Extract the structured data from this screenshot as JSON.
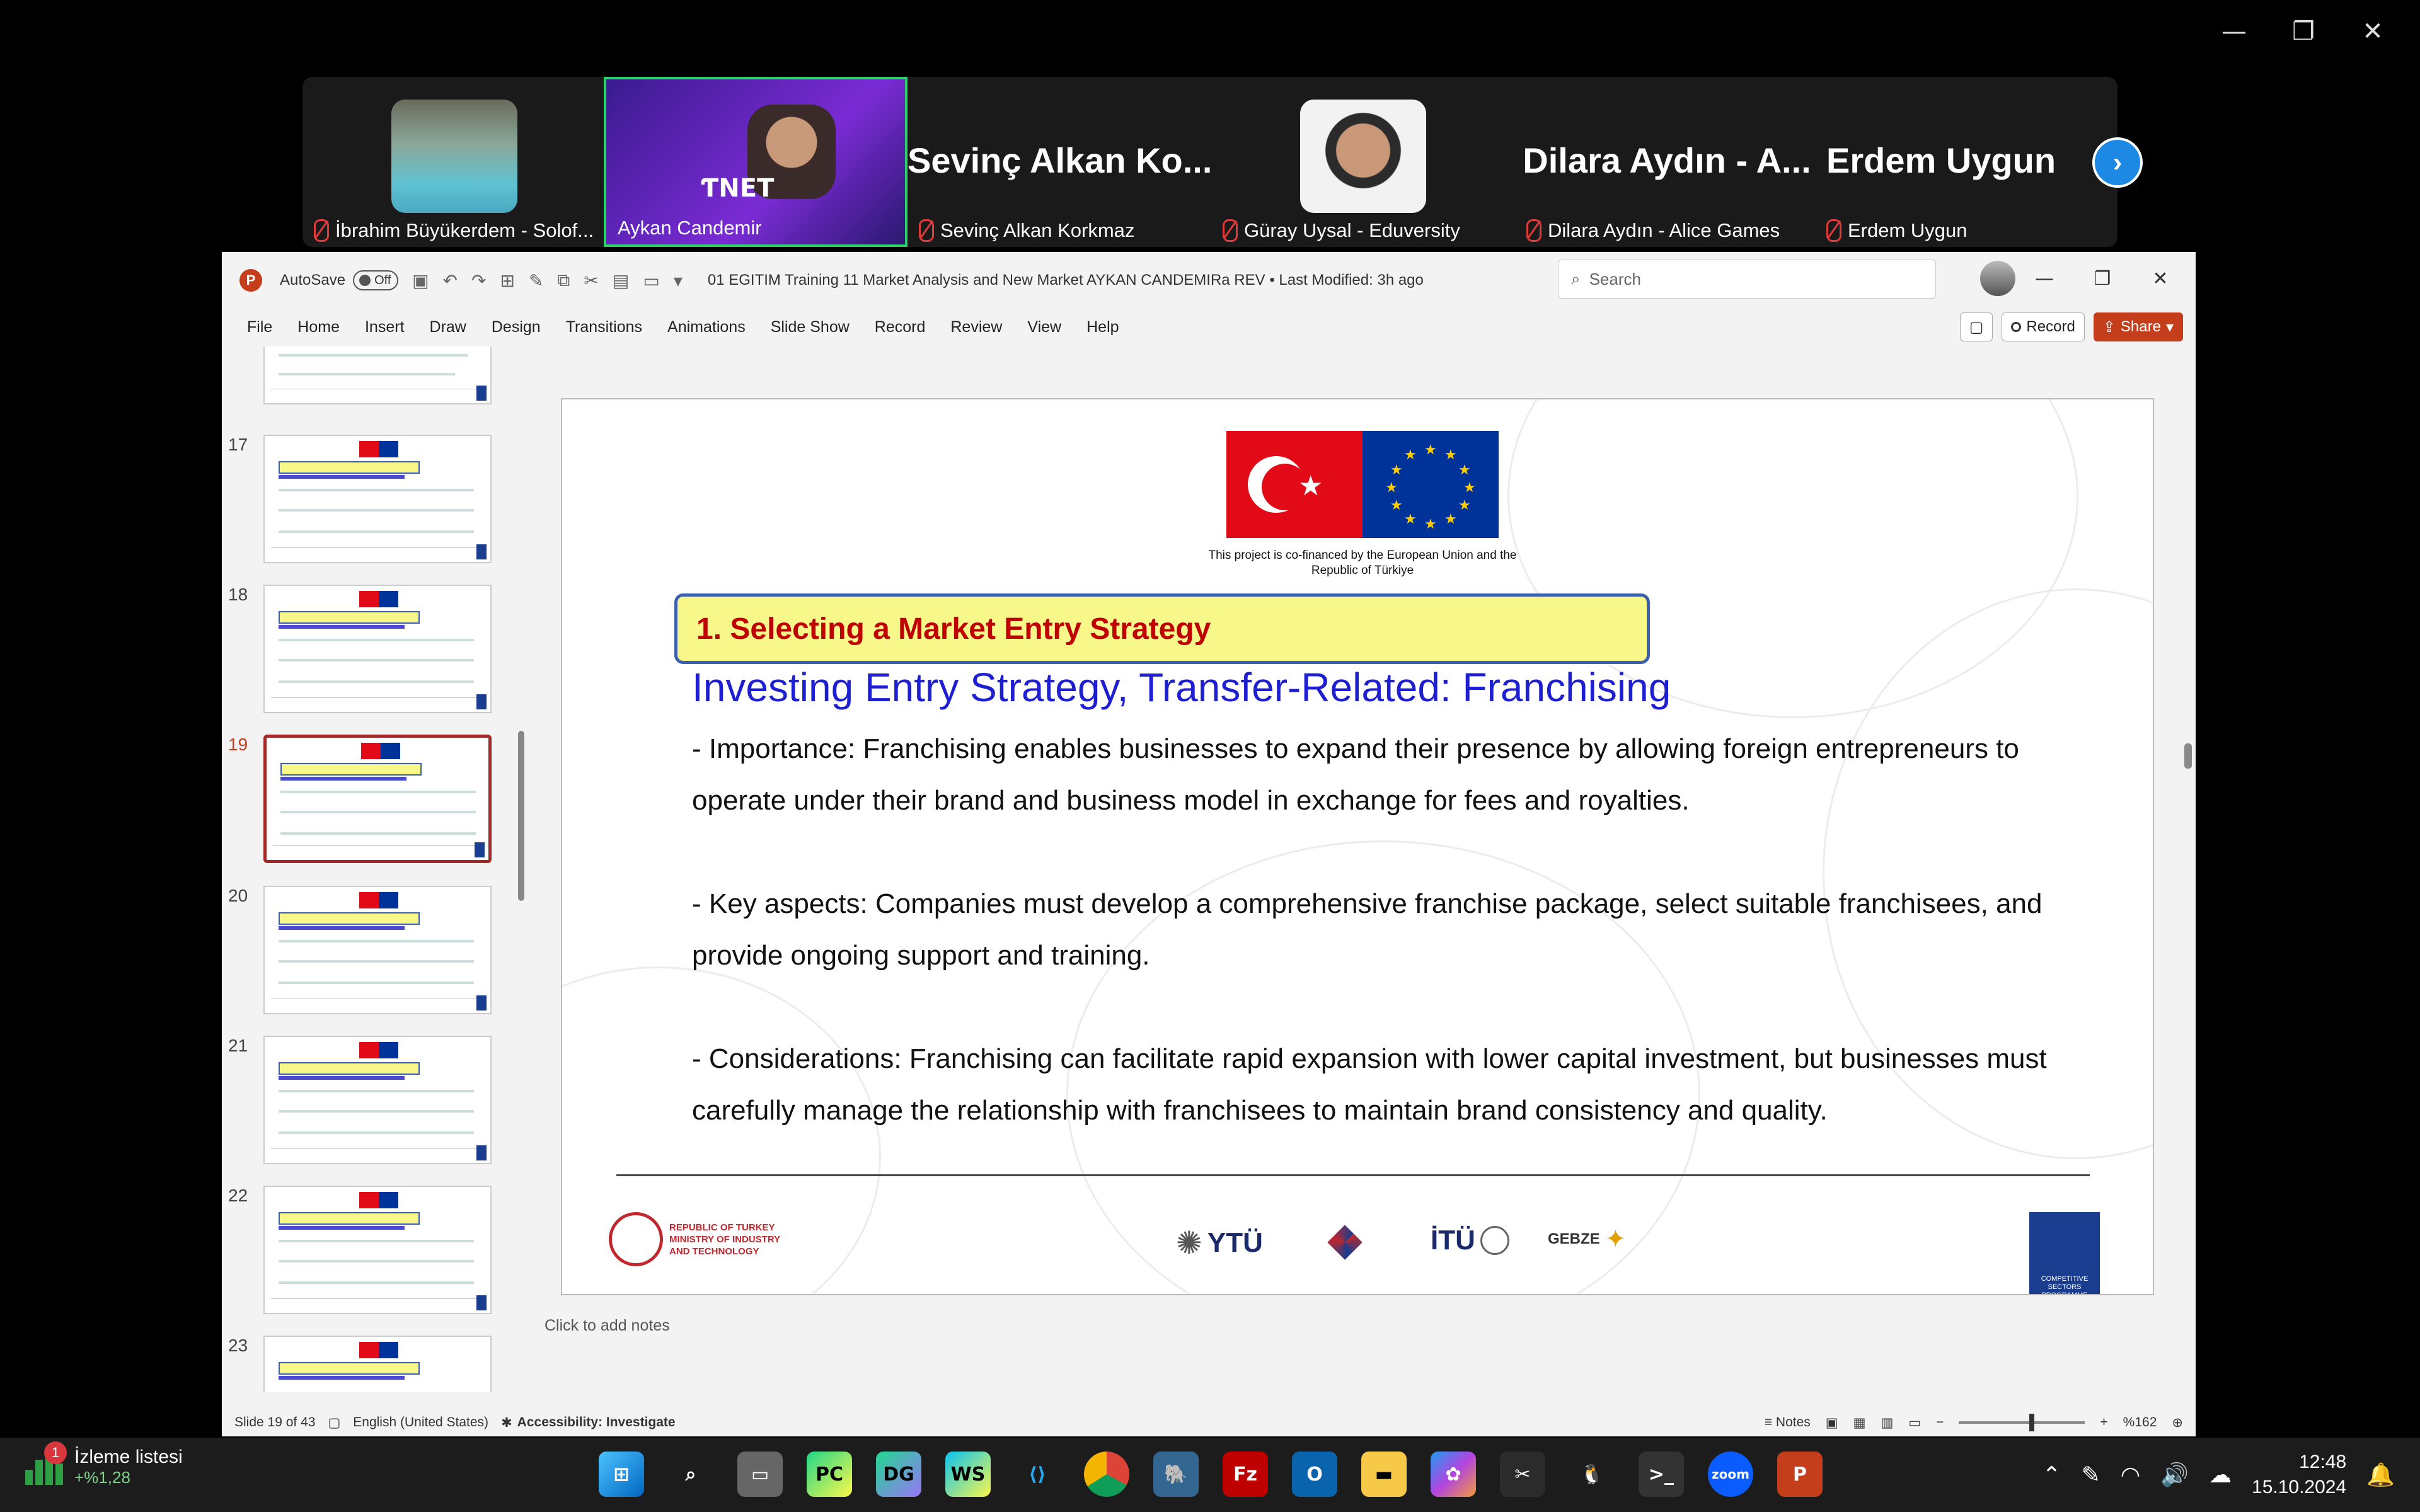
{
  "zoom": {
    "controls": {
      "minimize": "—",
      "restore": "❐",
      "close": "✕"
    },
    "participants": [
      {
        "name": "İbrahim Büyükerdem - Solof...",
        "display": "photo"
      },
      {
        "name": "Aykan Candemir",
        "display": "photo",
        "active": true
      },
      {
        "name": "Sevinç Alkan Korkmaz",
        "display": "text",
        "big_label": "Sevinç Alkan Ko..."
      },
      {
        "name": "Güray Uysal - Eduversity",
        "display": "photo"
      },
      {
        "name": "Dilara Aydın - Alice Games",
        "display": "text",
        "big_label": "Dilara Aydın - A..."
      },
      {
        "name": "Erdem Uygun",
        "display": "text",
        "big_label": "Erdem Uygun"
      }
    ],
    "next_icon": "chevron-right-icon",
    "next_glyph": "›"
  },
  "ppt": {
    "autosave_label": "AutoSave",
    "autosave_state": "Off",
    "doc_title": "01 EGITIM Training 11 Market Analysis and New Market AYKAN CANDEMIRa REV • Last Modified: 3h ago",
    "search_placeholder": "Search",
    "menu": [
      "File",
      "Home",
      "Insert",
      "Draw",
      "Design",
      "Transitions",
      "Animations",
      "Slide Show",
      "Record",
      "Review",
      "View",
      "Help"
    ],
    "record_label": "Record",
    "share_label": "Share",
    "thumb_numbers": [
      "17",
      "18",
      "19",
      "20",
      "21",
      "22",
      "23"
    ],
    "selected_slide": "19",
    "slide": {
      "cofinance": "This project is co-financed by the European Union and the Republic of Türkiye",
      "heading": "1. Selecting a Market Entry Strategy",
      "subtitle": "Investing Entry Strategy, Transfer-Related: Franchising",
      "paragraphs": [
        "- Importance: Franchising enables businesses to expand their presence by allowing foreign entrepreneurs to operate under their brand and business model in exchange for fees and royalties.",
        "- Key aspects: Companies must develop a comprehensive franchise package, select suitable franchisees, and provide ongoing support and training.",
        "- Considerations: Franchising can facilitate rapid expansion with lower capital investment, but businesses must carefully manage the relationship with franchisees to maintain brand consistency and quality."
      ],
      "logos": {
        "ministry": "REPUBLIC OF TURKEY MINISTRY OF INDUSTRY AND TECHNOLOGY",
        "ytu": "YTÜ",
        "itu": "İTÜ",
        "gebze": "GEBZE",
        "csp": "COMPETITIVE SECTORS PROGRAMME"
      }
    },
    "notes_placeholder": "Click to add notes",
    "status": {
      "slide_info": "Slide 19 of 43",
      "language": "English (United States)",
      "accessibility": "Accessibility: Investigate",
      "notes": "Notes",
      "zoom": "%162"
    }
  },
  "taskbar": {
    "widget_badge": "1",
    "widget_title": "İzleme listesi",
    "widget_value": "+%1,28",
    "time": "12:48",
    "date": "15.10.2024"
  }
}
